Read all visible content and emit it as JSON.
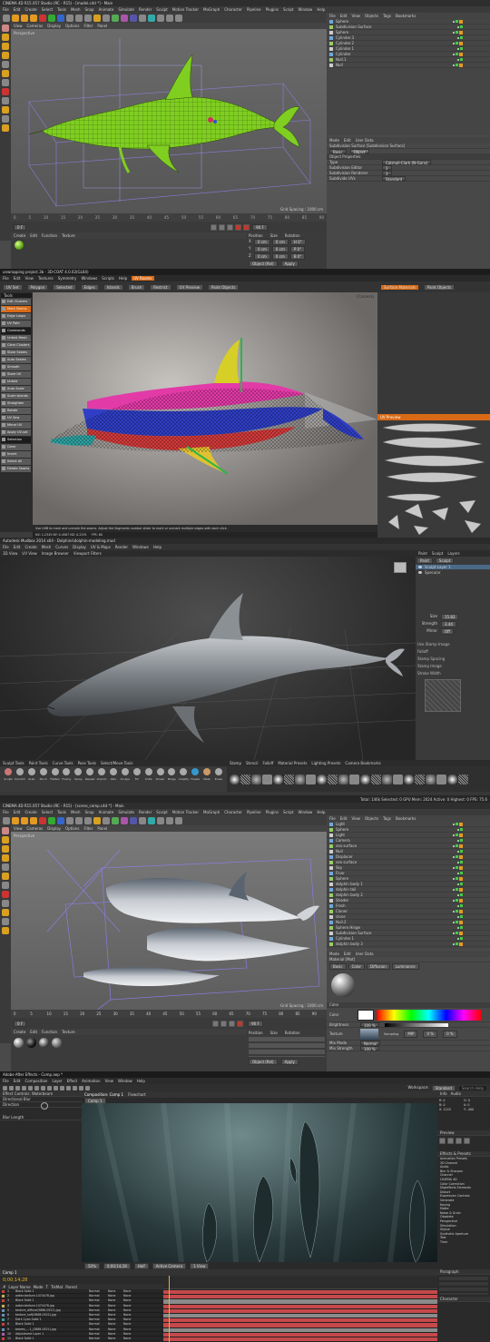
{
  "panels": {
    "c4d1": {
      "window_title": "CINEMA 4D R15.057 Studio (RC - R15) - [model.c4d *] - Main",
      "menus": [
        "File",
        "Edit",
        "Create",
        "Select",
        "Tools",
        "Mesh",
        "Snap",
        "Animate",
        "Simulate",
        "Render",
        "Sculpt",
        "Motion Tracker",
        "MoGraph",
        "Character",
        "Pipeline",
        "Plugins",
        "Script",
        "Window",
        "Help"
      ],
      "layout_label": "Layout:",
      "layout_value": "Startup",
      "viewport_menus": [
        "View",
        "Cameras",
        "Display",
        "Options",
        "Filter",
        "Panel"
      ],
      "viewport_label": "Perspective",
      "grid_spacing": "Grid Spacing : 1000 cm",
      "om_menus": [
        "File",
        "Edit",
        "View",
        "Objects",
        "Tags",
        "Bookmarks"
      ],
      "objects": [
        "Sphere",
        "Subdivision Surface",
        "Sphere",
        "Cylinder.3",
        "Cylinder.2",
        "Cylinder.1",
        "Cylinder",
        "Null.1",
        "Null"
      ],
      "attr_tabs": [
        "Mode",
        "Edit",
        "User Data"
      ],
      "attr_title": "Subdivision Surface [Subdivision Surface]",
      "attr_tab_basic": "Basic",
      "attr_tab_object": "Object",
      "attr_section": "Object Properties",
      "attr_rows": [
        {
          "label": "Type",
          "value": "Catmull-Clark (N-Gons)"
        },
        {
          "label": "Subdivision Editor",
          "value": "2"
        },
        {
          "label": "Subdivision Renderer",
          "value": "3"
        },
        {
          "label": "Subdivide UVs",
          "value": "Standard"
        }
      ],
      "timeline_ticks": [
        "0",
        "5",
        "10",
        "15",
        "20",
        "25",
        "30",
        "35",
        "40",
        "45",
        "50",
        "55",
        "60",
        "65",
        "70",
        "75",
        "80",
        "85",
        "90"
      ],
      "frame_start": "0 F",
      "frame_end": "90 F",
      "material_menus": [
        "Create",
        "Edit",
        "Function",
        "Texture"
      ],
      "coords_headers": [
        "Position",
        "Size",
        "Rotation"
      ],
      "coords": [
        {
          "axis": "X",
          "pos": "0 cm",
          "size": "0 cm",
          "rot": "H 0°"
        },
        {
          "axis": "Y",
          "pos": "0 cm",
          "size": "0 cm",
          "rot": "P 0°"
        },
        {
          "axis": "Z",
          "pos": "0 cm",
          "size": "0 cm",
          "rot": "B 0°"
        }
      ],
      "coords_mode": "Object (Rel)",
      "apply_label": "Apply"
    },
    "uv": {
      "window_title": "unwrapping project.3b - 3D-COAT 4.0.02(GL64)",
      "menus": [
        "File",
        "Edit",
        "View",
        "Textures",
        "Symmetry",
        "Windows",
        "Scripts",
        "Help",
        "UV Rooms"
      ],
      "toolbar_items": [
        "UV Set",
        "Polygon",
        "Selected",
        "Edges",
        "Islands",
        "Brush",
        "Restrict",
        "UV Preview",
        "Paint Objects"
      ],
      "left_header": "Tools",
      "tools": [
        "Edit Clusters",
        "Mark Seams",
        "Edge Loops",
        "UV Path",
        "Commands",
        "Unfold Mesh",
        "Clear Clusters",
        "Store Seams",
        "Auto Seams",
        "Smooth Seams",
        "Store UV",
        "Unfold",
        "Auto Scale",
        "Scale Islands",
        "Straighten",
        "Rotate",
        "UV Sew",
        "Mirror UV",
        "Apply UV-set",
        "Selection",
        "Clear",
        "Invert",
        "Select All",
        "Delete Seams"
      ],
      "viewport_label": "[Camera]",
      "right_tabs": [
        "Surface Materials",
        "Paint Objects"
      ],
      "uv_preview_label": "UV Preview",
      "status": "Use LMB to mark and unmark the seams. Adjust the Segments number slider to mark or unmark multiple edges with each click.",
      "coords": "NX: 1.2345  NY: 0.4567  NZ: 0.2291",
      "fps": "FPS: 60"
    },
    "mudbox": {
      "window_title": "Autodesk Mudbox 2014 x64 - Dolphins\\dolphin-modeling.mud",
      "menus": [
        "File",
        "Edit",
        "Create",
        "Mesh",
        "Curves",
        "Display",
        "UV & Maps",
        "Render",
        "Windows",
        "Help"
      ],
      "tabs": [
        "3D View",
        "UV View",
        "Image Browser",
        "Viewport Filters"
      ],
      "layer_tabs": [
        "Paint",
        "Sculpt",
        "Layers"
      ],
      "layer_buttons": [
        "Paint",
        "Sculpt"
      ],
      "layers": [
        "Sculpt Layer 1",
        "Specular"
      ],
      "props": [
        {
          "label": "Size",
          "value": "15.83"
        },
        {
          "label": "Strength",
          "value": "3.44"
        },
        {
          "label": "Mirror",
          "value": "Off"
        }
      ],
      "sections": [
        "Use Stamp Image",
        "Falloff",
        "Stamp Spacing",
        "Stamp Image",
        "Stroke Width"
      ],
      "tool_tabs": [
        "Sculpt Tools",
        "Paint Tools",
        "Curve Tools",
        "Pose Tools",
        "Select/Move Tools"
      ],
      "tools": [
        "Sculpt",
        "Smooth",
        "Grab",
        "Pinch",
        "Flatten",
        "Foamy",
        "Spray",
        "Repeat",
        "Imprint",
        "Wax",
        "Scrape",
        "Fill",
        "Knife",
        "Smear",
        "Bulge",
        "Amplify",
        "Freeze",
        "Mask",
        "Erase"
      ],
      "library_tabs": [
        "Stamp",
        "Stencil",
        "Falloff",
        "Material Presets",
        "Lighting Presets",
        "Camera Bookmarks"
      ],
      "status": "Total: 146k Selected: 0 GPU Mem: 2024 Active: 0 Highest: 0 FPS: 75.6"
    },
    "c4d2": {
      "window_title": "CINEMA 4D R15.057 Studio (RC - R15) - [scene_comp.c4d *] - Main",
      "menus": [
        "File",
        "Edit",
        "Create",
        "Select",
        "Tools",
        "Mesh",
        "Snap",
        "Animate",
        "Simulate",
        "Render",
        "Sculpt",
        "Motion Tracker",
        "MoGraph",
        "Character",
        "Pipeline",
        "Plugins",
        "Script",
        "Window",
        "Help"
      ],
      "viewport_menus": [
        "View",
        "Cameras",
        "Display",
        "Options",
        "Filter",
        "Panel"
      ],
      "viewport_label": "Perspective",
      "grid_spacing": "Grid Spacing : 1000 cm",
      "om_menus": [
        "File",
        "Edit",
        "View",
        "Objects",
        "Tags",
        "Bookmarks"
      ],
      "objects": [
        "Light",
        "Sphere",
        "Light",
        "Camera",
        "sea surface",
        "Null",
        "Displacer",
        "sea surface",
        "Sky",
        "Floor",
        "Sphere",
        "dolphin body 1",
        "dolphin tail",
        "dolphin body 2",
        "Shader",
        "Fresh",
        "Cloner",
        "clone",
        "Null.2",
        "Sphere.Hinge",
        "Subdivision Surface",
        "Cylinder.1",
        "dolphin body 3"
      ],
      "attr_tabs": [
        "Mode",
        "Edit",
        "User Data"
      ],
      "attr_title": "Material [Mat]",
      "attr_subtabs": [
        "Basic",
        "Color",
        "Diffusion",
        "Luminance"
      ],
      "color_section": "Color",
      "color_label": "Color",
      "brightness_label": "Brightness",
      "brightness_value": "100 %",
      "texture_label": "Texture",
      "mix_mode_label": "Mix Mode",
      "mix_mode_value": "Normal",
      "mix_strength_label": "Mix Strength",
      "mix_strength_value": "100 %",
      "sampling_label": "Sampling",
      "sampling_value": "MIP",
      "blur_offset": "0 %",
      "blur_scale": "0 %",
      "frame_start": "0 F",
      "frame_end": "90 F",
      "material_menus": [
        "Create",
        "Edit",
        "Function",
        "Texture"
      ],
      "coords_headers": [
        "Position",
        "Size",
        "Rotation"
      ],
      "coords_mode": "Object (Rel)",
      "apply_label": "Apply"
    },
    "ae": {
      "window_title": "Adobe After Effects - Comp.aep *",
      "menus": [
        "File",
        "Edit",
        "Composition",
        "Layer",
        "Effect",
        "Animation",
        "View",
        "Window",
        "Help"
      ],
      "workspace_label": "Workspace:",
      "workspace_value": "Standard",
      "search_placeholder": "Search Help",
      "effect_controls_tab": "Effect Controls: Waterbeam",
      "effect_name": "Directional Blur",
      "effect_direction_label": "Direction",
      "effect_blur_label": "Blur Length",
      "composition_tab": "Composition: Comp 1",
      "flowchart_tab": "Flowchart",
      "comp_label": "Comp 1",
      "viewer_zoom": "50%",
      "viewer_time": "0;00;14;28",
      "viewer_quality": "Half",
      "viewer_view": "Active Camera",
      "viewer_views": "1 View",
      "info_tab": "Info",
      "audio_tab": "Audio",
      "info_values": [
        "R: 0",
        "G: 0",
        "B: 0",
        "A: 0",
        "X: 1243",
        "Y: -400"
      ],
      "preview_tab": "Preview",
      "effects_tab": "Effects & Presets",
      "effects_list": [
        "Animation Presets",
        "3D Channel",
        "Audio",
        "Blur & Sharpen",
        "Channel",
        "CINEMA 4D",
        "Color Correction",
        "Digieffects Elements",
        "Distort",
        "Expression Controls",
        "Generate",
        "Keying",
        "Matte",
        "Noise & Grain",
        "Obsolete",
        "Perspective",
        "Simulation",
        "Stylize",
        "Synthetic Aperture",
        "Text",
        "Time"
      ],
      "timeline_comp_tab": "Comp 1",
      "timeline_time": "0;00;14;28",
      "timeline_columns": [
        "#",
        "Layer Name",
        "Mode",
        "T",
        "TrkMat",
        "Parent"
      ],
      "layers": [
        {
          "num": "1",
          "name": "Black Solid 1",
          "mode": "Normal",
          "trkmat": "None",
          "parent": "None",
          "color": "#c7413b"
        },
        {
          "num": "2",
          "name": "water-texture-1474478.jpg",
          "mode": "Normal",
          "trkmat": "None",
          "parent": "None",
          "color": "#c5b04b"
        },
        {
          "num": "3",
          "name": "Black Solid 1",
          "mode": "Normal",
          "trkmat": "None",
          "parent": "None",
          "color": "#c7413b"
        },
        {
          "num": "4",
          "name": "water-texture-1474478.jpg",
          "mode": "Normal",
          "trkmat": "None",
          "parent": "None",
          "color": "#c5b04b"
        },
        {
          "num": "5",
          "name": "texture_diffuse(3888-0522).jpg",
          "mode": "Normal",
          "trkmat": "None",
          "parent": "None",
          "color": "#6c8fb5"
        },
        {
          "num": "6",
          "name": "texture_soft(3888-0522).jpg",
          "mode": "Normal",
          "trkmat": "None",
          "parent": "None",
          "color": "#6c8fb5"
        },
        {
          "num": "7",
          "name": "Dark Cyan Solid 1",
          "mode": "Normal",
          "trkmat": "None",
          "parent": "None",
          "color": "#3c9a9a"
        },
        {
          "num": "8",
          "name": "Black Solid 1",
          "mode": "Normal",
          "trkmat": "None",
          "parent": "None",
          "color": "#c7413b"
        },
        {
          "num": "9",
          "name": "beams_...1_(3888-0522).jpg",
          "mode": "Normal",
          "trkmat": "None",
          "parent": "None",
          "color": "#6c8fb5"
        },
        {
          "num": "10",
          "name": "Adjustment Layer 1",
          "mode": "Normal",
          "trkmat": "None",
          "parent": "None",
          "color": "#b15ea8"
        },
        {
          "num": "11",
          "name": "Black Solid 1",
          "mode": "Normal",
          "trkmat": "None",
          "parent": "None",
          "color": "#c7413b"
        }
      ],
      "paragraph_tab": "Paragraph",
      "character_tab": "Character"
    }
  },
  "colors": {
    "c4d_orange": "#e39a22",
    "uv_orange": "#d86a16",
    "ae_track_red": "#c5494b",
    "ae_track_gray": "#8b8b8b",
    "dolphin_green": "#7fce20"
  }
}
